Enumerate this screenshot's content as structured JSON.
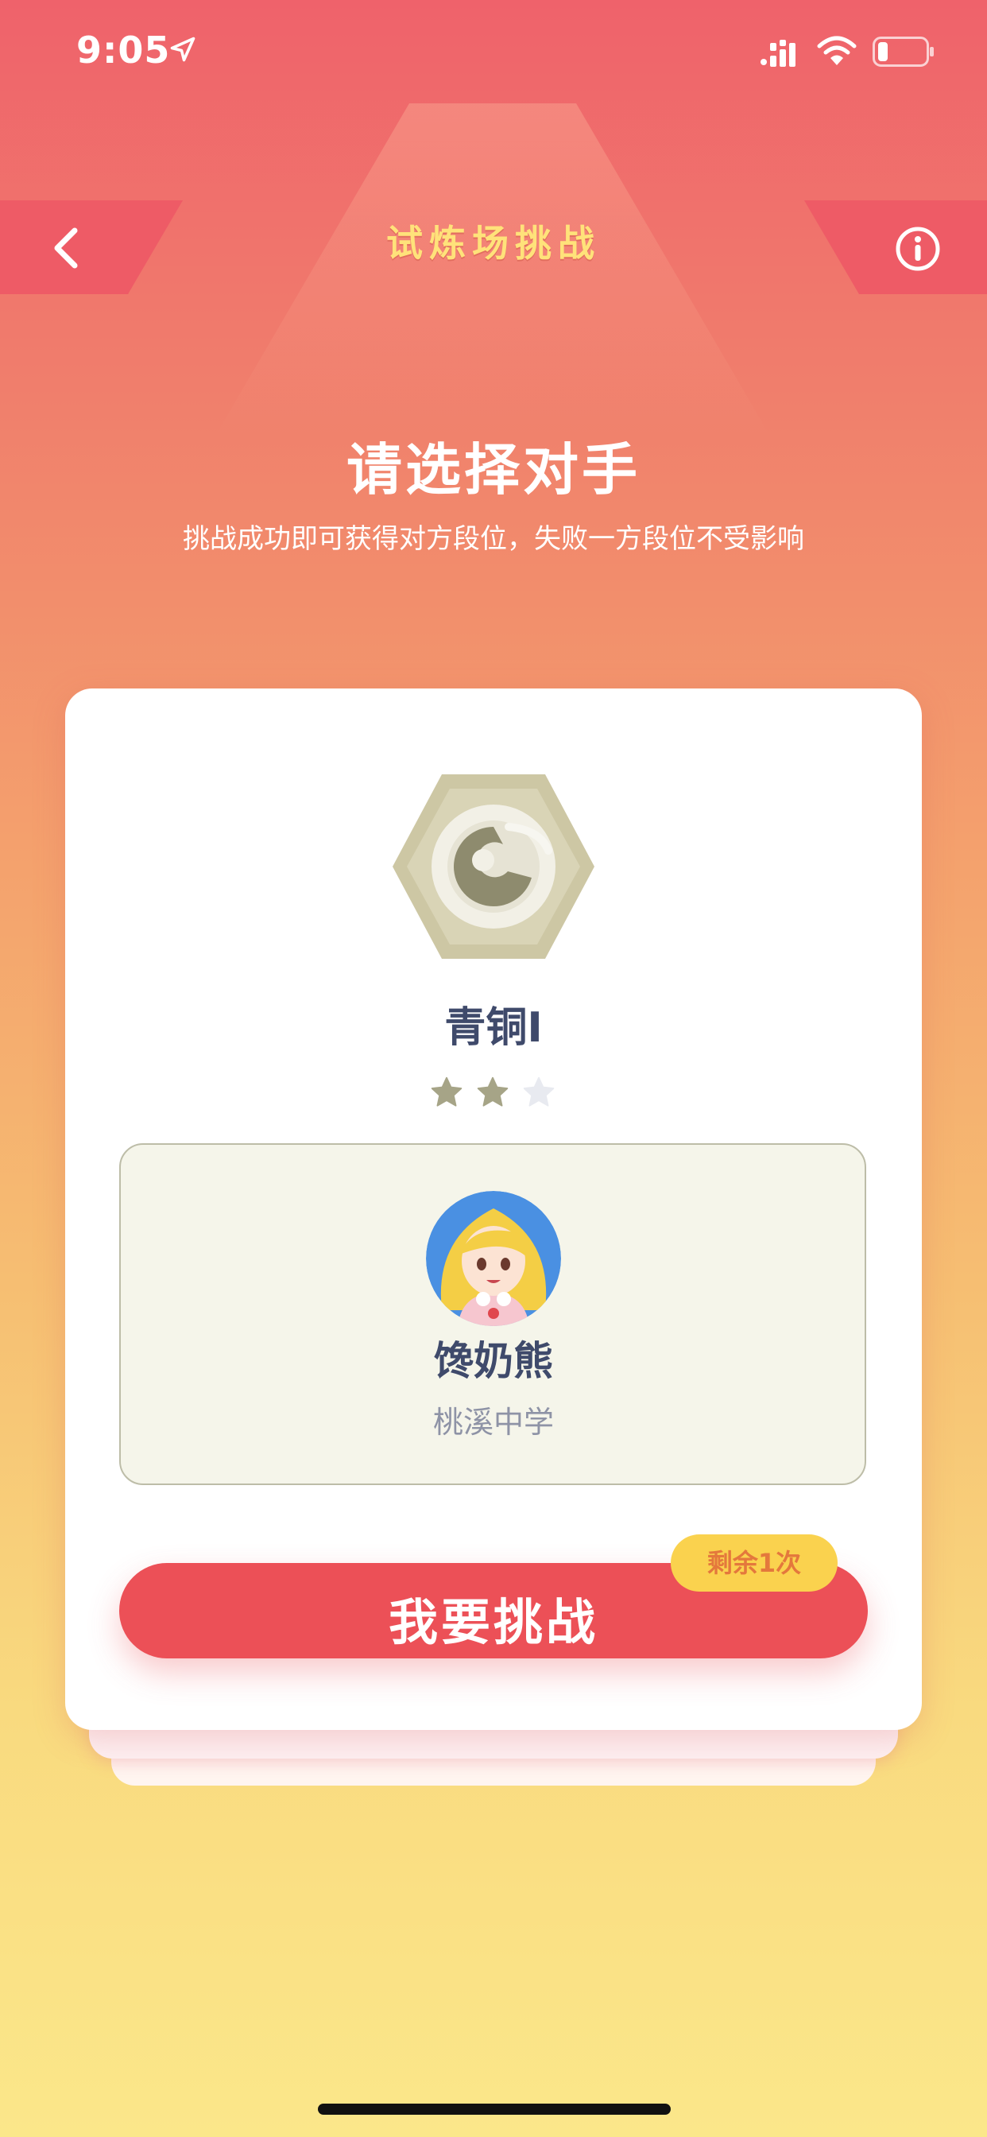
{
  "status_bar": {
    "time": "9:05"
  },
  "nav": {
    "title": "试炼场挑战"
  },
  "heading": {
    "title": "请选择对手",
    "subtitle": "挑战成功即可获得对方段位，失败一方段位不受影响"
  },
  "rank": {
    "name": "青铜I",
    "stars_filled": 2,
    "stars_total": 3
  },
  "opponent": {
    "name": "馋奶熊",
    "school": "桃溪中学"
  },
  "action": {
    "challenge_label": "我要挑战",
    "remaining_label": "剩余1次"
  },
  "colors": {
    "accent": "#EC5057",
    "title_yellow": "#FFE27A",
    "badge_yellow": "#FAD24E",
    "text_dark": "#3F4A6B",
    "text_muted": "#8E93A6"
  }
}
